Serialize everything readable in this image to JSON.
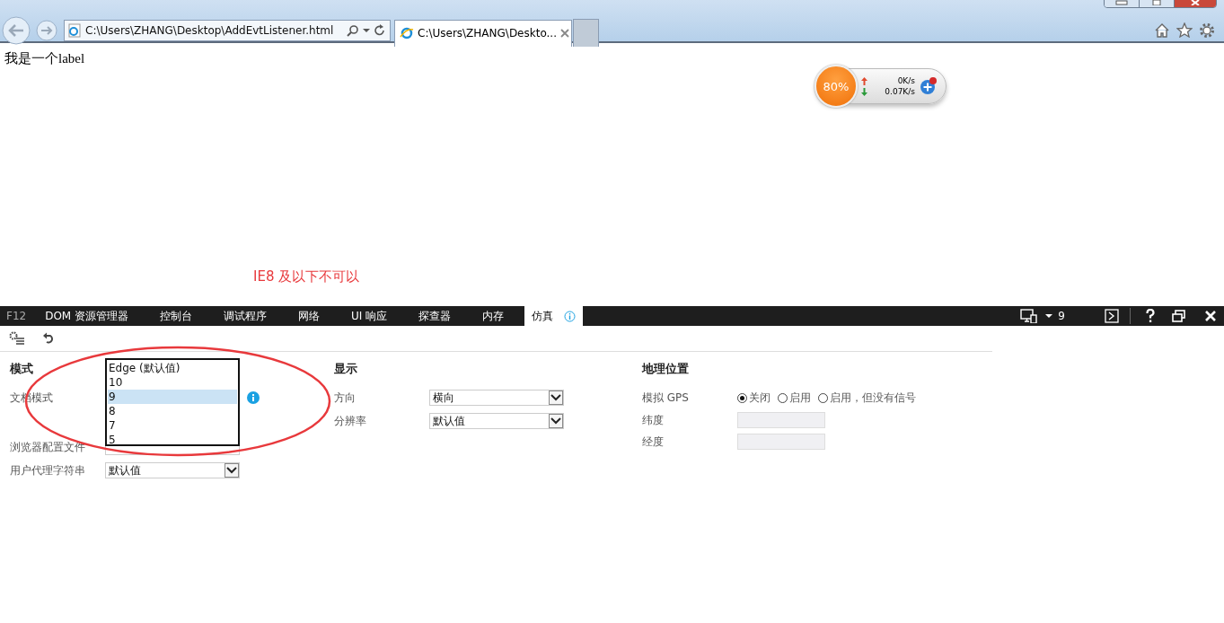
{
  "browser": {
    "address": "C:\\Users\\ZHANG\\Desktop\\AddEvtListener.html",
    "tabs": [
      {
        "title": "C:\\Users\\ZHANG\\Deskto...",
        "selected": true
      }
    ]
  },
  "page": {
    "label_text": "我是一个label",
    "note": "IE8 及以下不可以",
    "speed_widget": {
      "percent": "80%",
      "upload": "0K/s",
      "download": "0.07K/s"
    }
  },
  "devtools": {
    "f12_label": "F12",
    "tabs": [
      {
        "label": "DOM 资源管理器",
        "selected": false
      },
      {
        "label": "控制台",
        "selected": false
      },
      {
        "label": "调试程序",
        "selected": false
      },
      {
        "label": "网络",
        "selected": false
      },
      {
        "label": "UI 响应",
        "selected": false
      },
      {
        "label": "探查器",
        "selected": false
      },
      {
        "label": "内存",
        "selected": false
      },
      {
        "label": "仿真",
        "selected": true
      }
    ],
    "document_mode_badge": "9",
    "mode": {
      "title": "模式",
      "document_mode_label": "文档模式",
      "dropdown_options": [
        {
          "label": "Edge (默认值)",
          "selected": false
        },
        {
          "label": "10",
          "selected": false
        },
        {
          "label": "9",
          "selected": true
        },
        {
          "label": "8",
          "selected": false
        },
        {
          "label": "7",
          "selected": false
        },
        {
          "label": "5",
          "selected": false
        }
      ],
      "browser_profile_label": "浏览器配置文件",
      "user_agent_label": "用户代理字符串",
      "user_agent_value": "默认值"
    },
    "display": {
      "title": "显示",
      "rows": [
        {
          "label": "方向",
          "value": "横向"
        },
        {
          "label": "分辨率",
          "value": "默认值"
        }
      ]
    },
    "geolocation": {
      "title": "地理位置",
      "gps_label": "模拟 GPS",
      "gps_options": [
        {
          "label": "关闭",
          "selected": true
        },
        {
          "label": "启用",
          "selected": false
        },
        {
          "label": "启用，但没有信号",
          "selected": false
        }
      ],
      "latitude_label": "纬度",
      "longitude_label": "经度"
    }
  }
}
